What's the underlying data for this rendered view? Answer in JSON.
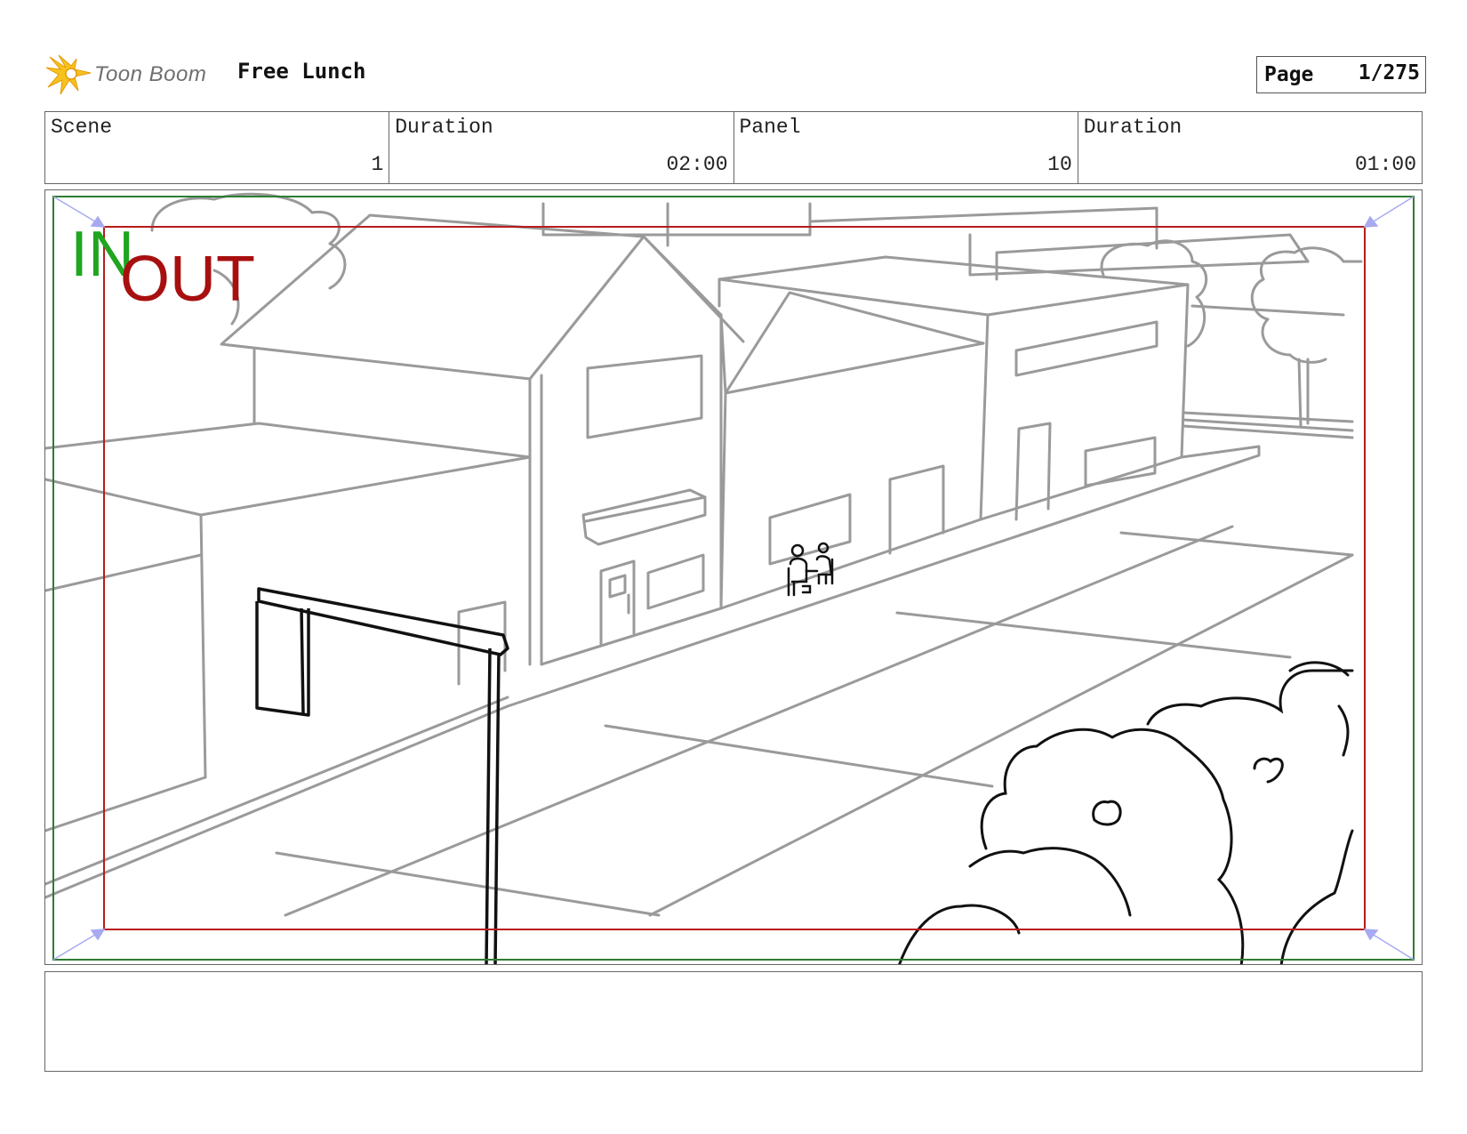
{
  "header": {
    "logo_text": "Toon Boom",
    "project_title": "Free Lunch",
    "page_label": "Page",
    "page_number": "1/275"
  },
  "info": {
    "scene_label": "Scene",
    "scene_value": "1",
    "scene_duration_label": "Duration",
    "scene_duration_value": "02:00",
    "panel_label": "Panel",
    "panel_value": "10",
    "panel_duration_label": "Duration",
    "panel_duration_value": "01:00"
  },
  "panel": {
    "in_label": "IN",
    "out_label": "OUT",
    "safe_frame_color": "#2e7d32",
    "action_frame_color": "#b71c1c",
    "sketch_gray": "#9a9a9a",
    "sketch_black": "#111111"
  },
  "notes": {
    "text": ""
  }
}
